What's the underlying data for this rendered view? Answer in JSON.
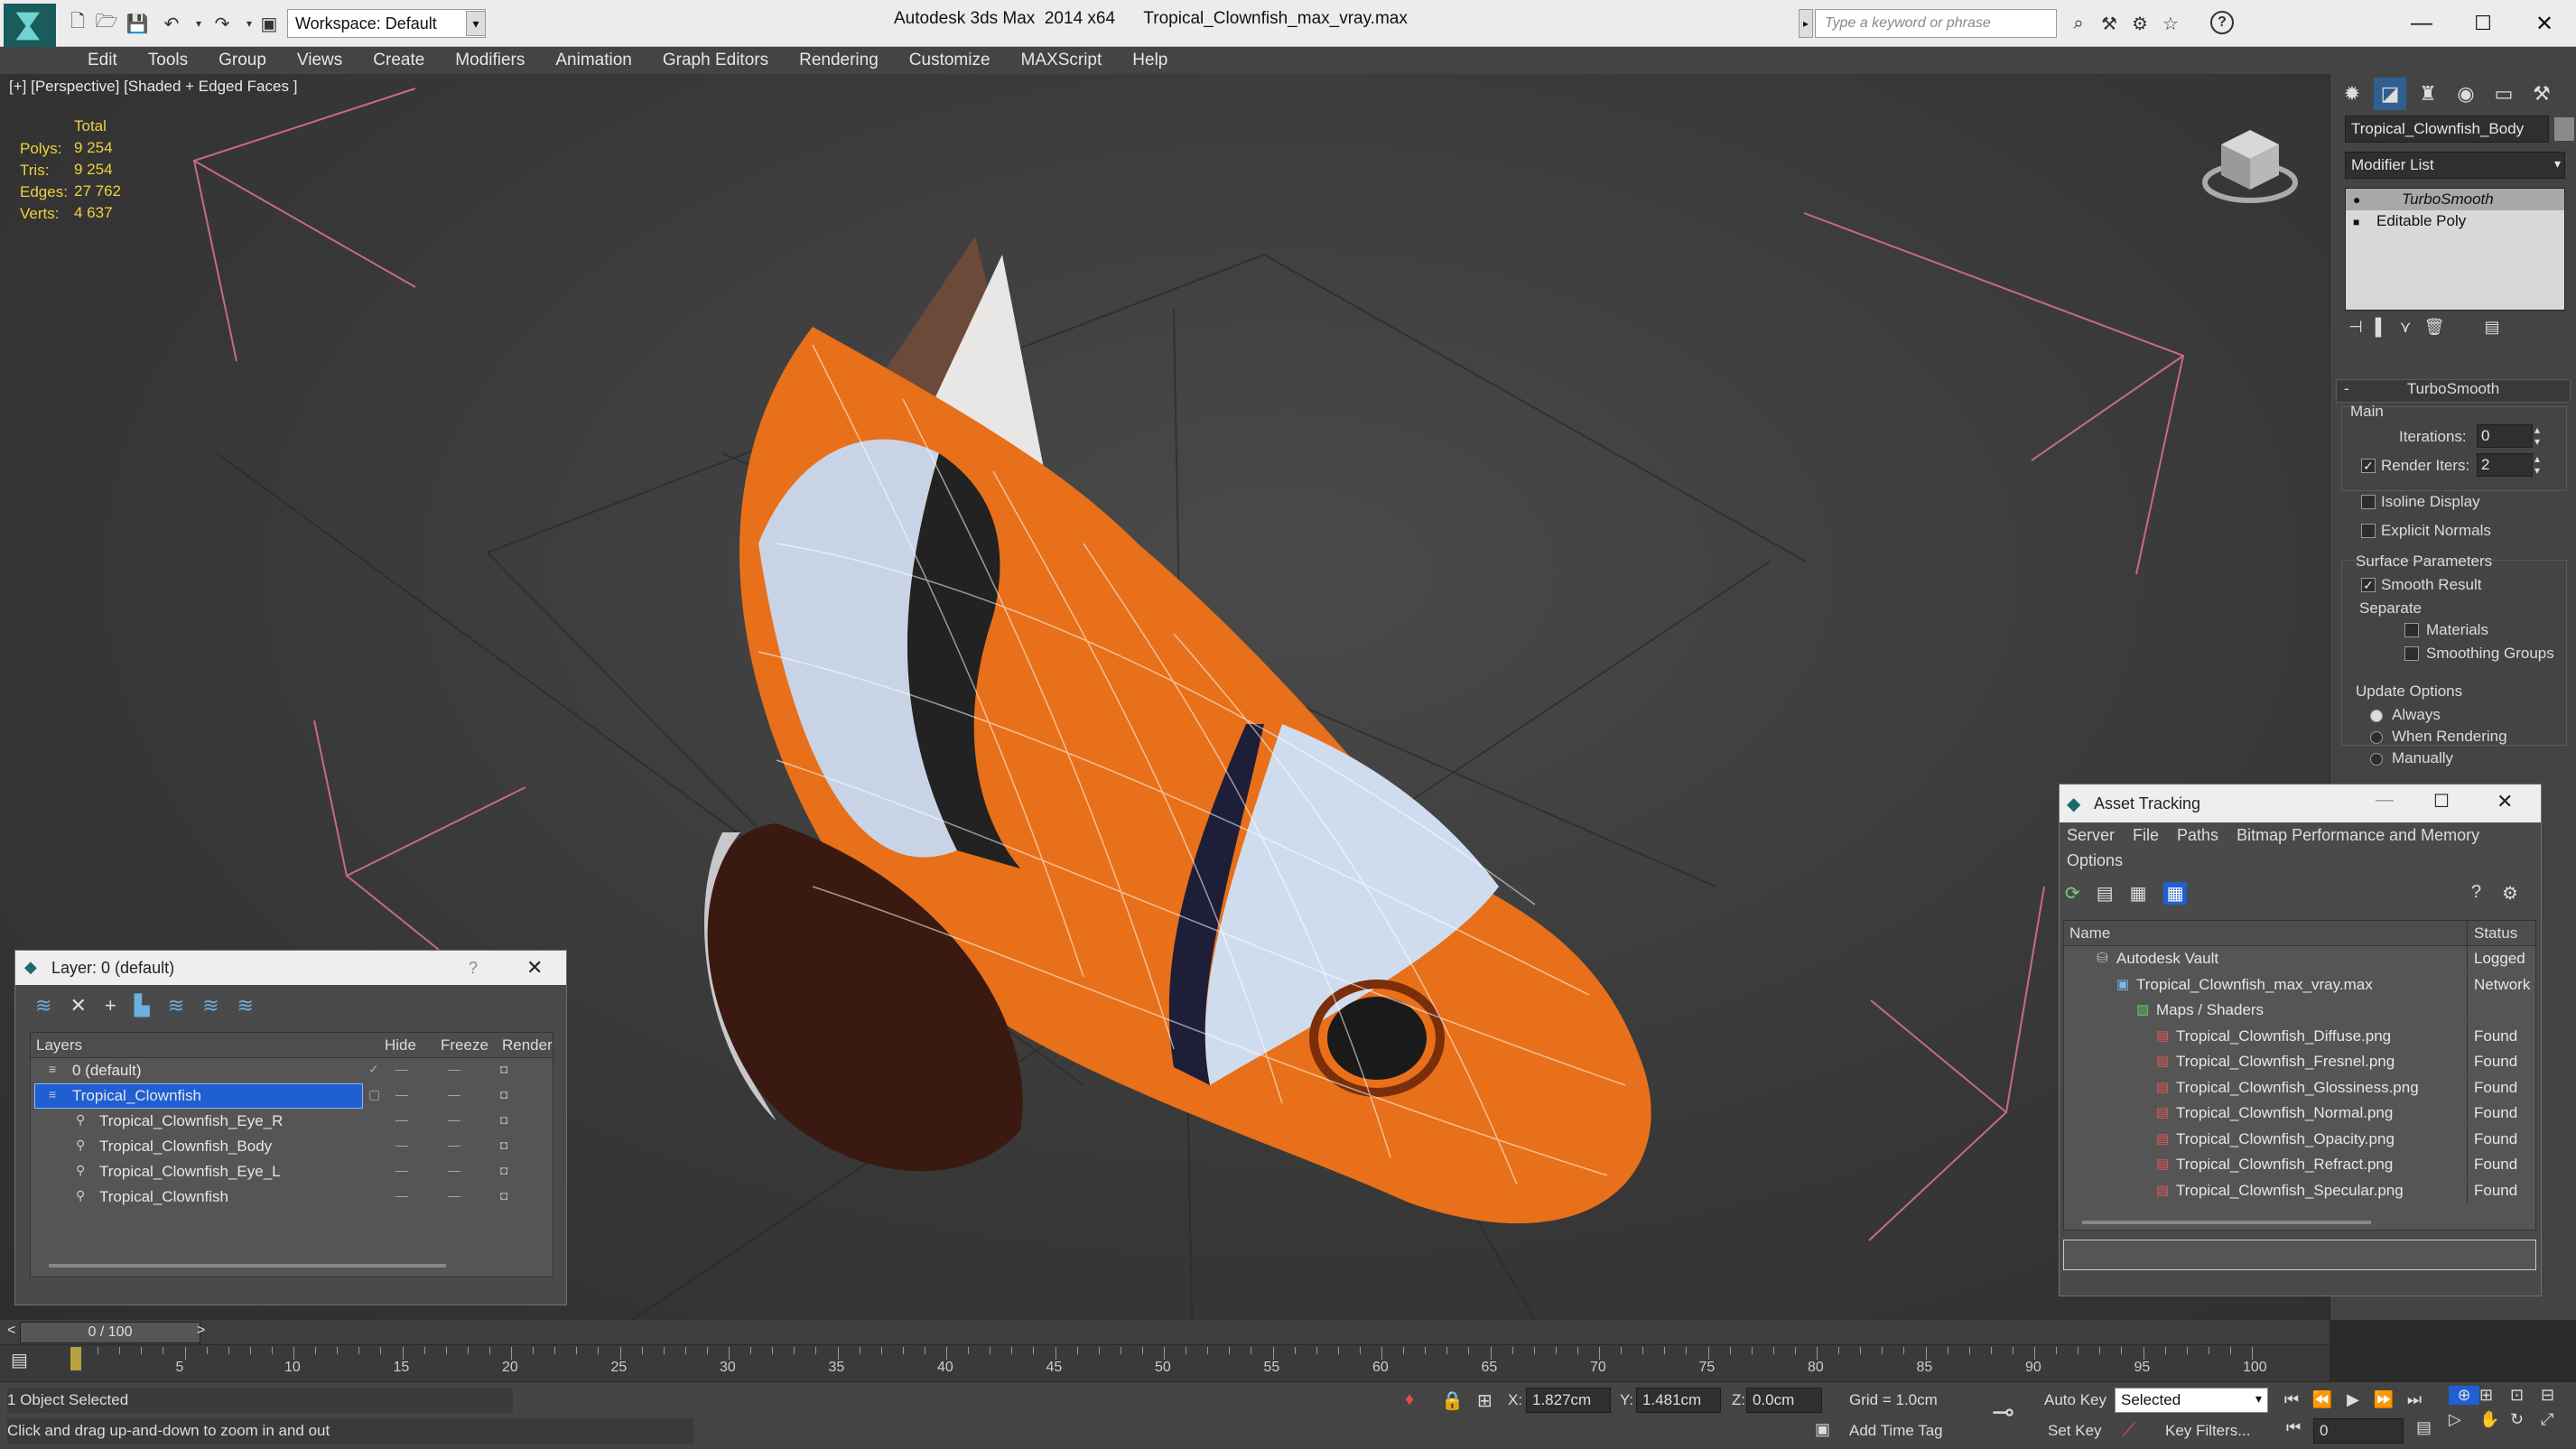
{
  "title_bar": {
    "app_title": "Autodesk 3ds Max  2014 x64      Tropical_Clownfish_max_vray.max",
    "workspace_label": "Workspace: Default",
    "search_placeholder": "Type a keyword or phrase"
  },
  "menu": [
    "Edit",
    "Tools",
    "Group",
    "Views",
    "Create",
    "Modifiers",
    "Animation",
    "Graph Editors",
    "Rendering",
    "Customize",
    "MAXScript",
    "Help"
  ],
  "viewport": {
    "label": "[+] [Perspective] [Shaded + Edged Faces ]",
    "stats": {
      "header": "Total",
      "rows": [
        {
          "label": "Polys:",
          "value": "9 254"
        },
        {
          "label": "Tris:",
          "value": "9 254"
        },
        {
          "label": "Edges:",
          "value": "27 762"
        },
        {
          "label": "Verts:",
          "value": "4 637"
        }
      ]
    }
  },
  "command_panel": {
    "object_name": "Tropical_Clownfish_Body",
    "modifier_list_label": "Modifier List",
    "stack": [
      "TurboSmooth",
      "Editable Poly"
    ],
    "rollout_title": "TurboSmooth",
    "main_label": "Main",
    "iterations_label": "Iterations:",
    "iterations_value": "0",
    "render_iters_label": "Render Iters:",
    "render_iters_value": "2",
    "isoline_label": "Isoline Display",
    "explicit_normals_label": "Explicit Normals",
    "surface_params_label": "Surface Parameters",
    "smooth_result_label": "Smooth Result",
    "separate_label": "Separate",
    "materials_label": "Materials",
    "smoothing_groups_label": "Smoothing Groups",
    "update_options_label": "Update Options",
    "always_label": "Always",
    "when_rendering_label": "When Rendering",
    "manually_label": "Manually"
  },
  "layer_panel": {
    "title": "Layer: 0 (default)",
    "help": "?",
    "columns": [
      "Layers",
      "Hide",
      "Freeze",
      "Render"
    ],
    "rows": [
      {
        "name": "0 (default)",
        "indent": 1,
        "selected": false
      },
      {
        "name": "Tropical_Clownfish",
        "indent": 1,
        "selected": true
      },
      {
        "name": "Tropical_Clownfish_Eye_R",
        "indent": 2,
        "selected": false
      },
      {
        "name": "Tropical_Clownfish_Body",
        "indent": 2,
        "selected": false
      },
      {
        "name": "Tropical_Clownfish_Eye_L",
        "indent": 2,
        "selected": false
      },
      {
        "name": "Tropical_Clownfish",
        "indent": 2,
        "selected": false
      }
    ]
  },
  "asset_panel": {
    "title": "Asset Tracking",
    "menu": [
      "Server",
      "File",
      "Paths",
      "Bitmap Performance and Memory"
    ],
    "menu2": "Options",
    "columns": [
      "Name",
      "Status"
    ],
    "rows": [
      {
        "name": "Autodesk Vault",
        "status": "Logged",
        "indent": 1,
        "icon": "vault-icon"
      },
      {
        "name": "Tropical_Clownfish_max_vray.max",
        "status": "Network",
        "indent": 2,
        "icon": "max-file-icon"
      },
      {
        "name": "Maps / Shaders",
        "status": "",
        "indent": 3,
        "icon": "maps-icon"
      },
      {
        "name": "Tropical_Clownfish_Diffuse.png",
        "status": "Found",
        "indent": 4,
        "icon": "png-icon"
      },
      {
        "name": "Tropical_Clownfish_Fresnel.png",
        "status": "Found",
        "indent": 4,
        "icon": "png-icon"
      },
      {
        "name": "Tropical_Clownfish_Glossiness.png",
        "status": "Found",
        "indent": 4,
        "icon": "png-icon"
      },
      {
        "name": "Tropical_Clownfish_Normal.png",
        "status": "Found",
        "indent": 4,
        "icon": "png-icon"
      },
      {
        "name": "Tropical_Clownfish_Opacity.png",
        "status": "Found",
        "indent": 4,
        "icon": "png-icon"
      },
      {
        "name": "Tropical_Clownfish_Refract.png",
        "status": "Found",
        "indent": 4,
        "icon": "png-icon"
      },
      {
        "name": "Tropical_Clownfish_Specular.png",
        "status": "Found",
        "indent": 4,
        "icon": "png-icon"
      }
    ]
  },
  "timeline": {
    "frame_label": "0 / 100",
    "ticks": [
      "5",
      "10",
      "15",
      "20",
      "25",
      "30",
      "35",
      "40",
      "45",
      "50",
      "55",
      "60",
      "65",
      "70",
      "75",
      "80",
      "85",
      "90",
      "95",
      "100"
    ]
  },
  "status_bar": {
    "selection": "1 Object Selected",
    "prompt": "Click and drag up-and-down to zoom in and out",
    "x_label": "X:",
    "x_value": "1.827cm",
    "y_label": "Y:",
    "y_value": "1.481cm",
    "z_label": "Z:",
    "z_value": "0.0cm",
    "grid": "Grid = 1.0cm",
    "add_time_tag": "Add Time Tag",
    "auto_key": "Auto Key",
    "set_key": "Set Key",
    "selected_option": "Selected",
    "key_filters": "Key Filters...",
    "frame_value": "0"
  },
  "colors": {
    "accent_blue": "#1f5fd1",
    "stat_yellow": "#f0d040",
    "fish_orange": "#e8701a"
  }
}
